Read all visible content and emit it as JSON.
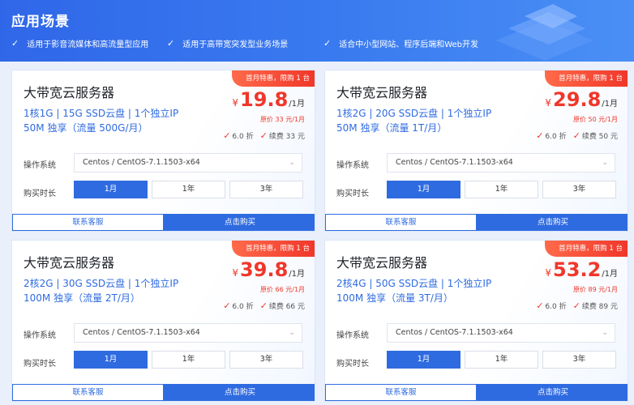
{
  "header": {
    "title": "应用场景",
    "features": [
      "适用于影音流媒体和高流量型应用",
      "适用于高带宽突发型业务场景",
      "适合中小型网站、程序后端和Web开发"
    ]
  },
  "colors": {
    "accent": "#2f6be0",
    "promo": "#f0372a",
    "hero": "#3a7bf0"
  },
  "common": {
    "os_label": "操作系统",
    "duration_label": "购买时长",
    "os_value": "Centos / CentOS-7.1.1503-x64",
    "durations": [
      "1月",
      "1年",
      "3年"
    ],
    "contact": "联系客服",
    "buy": "点击购买",
    "ribbon": "首月特惠，限购 1 台",
    "currency": "¥",
    "per_month": "/1月",
    "discount": "6.0 折"
  },
  "cards": [
    {
      "title": "大带宽云服务器",
      "spec": "1核1G  |  15G SSD云盘  |  1个独立IP",
      "net": "50M 独享（流量 500G/月）",
      "price": "19.8",
      "orig": "原价 33 元/1月",
      "renew": "续费 33 元"
    },
    {
      "title": "大带宽云服务器",
      "spec": "1核2G  |  20G SSD云盘  |  1个独立IP",
      "net": "50M 独享（流量 1T/月）",
      "price": "29.8",
      "orig": "原价 50 元/1月",
      "renew": "续费 50 元"
    },
    {
      "title": "大带宽云服务器",
      "spec": "2核2G  |  30G SSD云盘  |  1个独立IP",
      "net": "100M 独享（流量 2T/月）",
      "price": "39.8",
      "orig": "原价 66 元/1月",
      "renew": "续费 66 元"
    },
    {
      "title": "大带宽云服务器",
      "spec": "2核4G  |  50G SSD云盘  |  1个独立IP",
      "net": "100M 独享（流量 3T/月）",
      "price": "53.2",
      "orig": "原价 89 元/1月",
      "renew": "续费 89 元"
    }
  ]
}
